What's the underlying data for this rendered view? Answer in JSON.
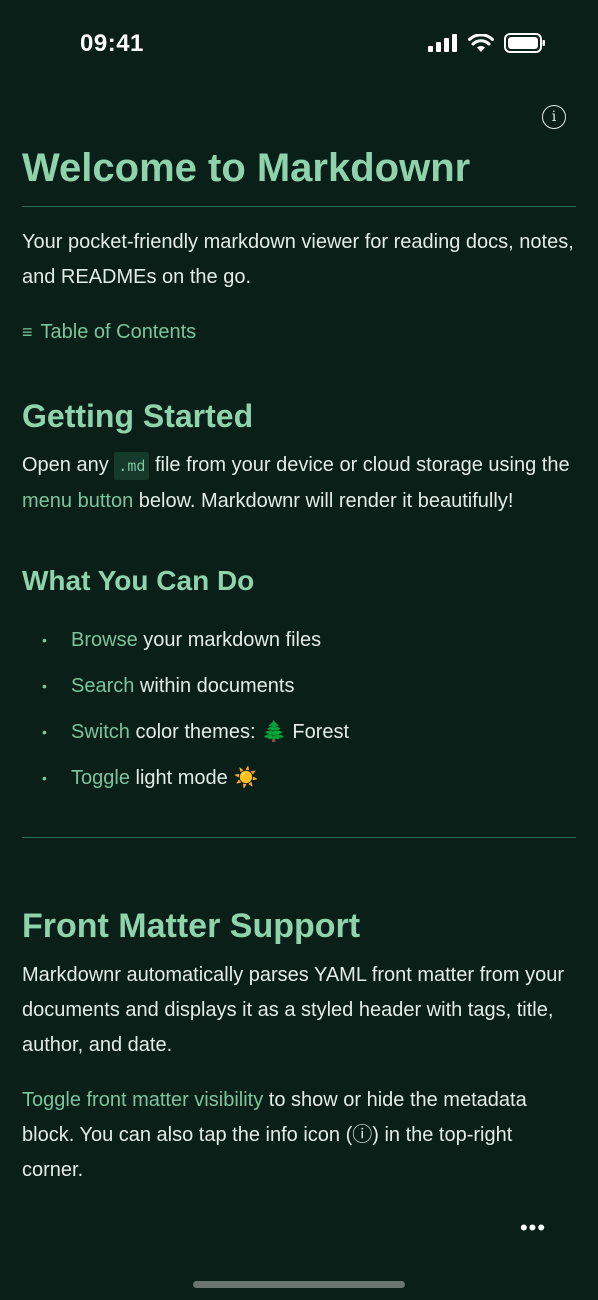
{
  "status_bar": {
    "time": "09:41",
    "icons": [
      "cellular-signal-icon",
      "wifi-icon",
      "battery-icon"
    ]
  },
  "header": {
    "info_icon": "info-icon",
    "info_glyph": "i"
  },
  "document": {
    "title": "Welcome to Markdownr",
    "intro": "Your pocket-friendly markdown viewer for reading docs, notes, and READMEs on the go.",
    "toc_icon": "≡",
    "toc_label": "Table of Contents",
    "getting_started": {
      "heading": "Getting Started",
      "text_1": "Open any ",
      "code": ".md",
      "text_2": " file from your device or cloud storage using the ",
      "link": "menu button",
      "text_3": " below. Markdownr will render it beautifully!"
    },
    "what_you_can_do": {
      "heading": "What You Can Do",
      "bullet_glyph": "•",
      "items": [
        {
          "link": "Browse",
          "text": " your markdown files",
          "emoji": "",
          "suffix": ""
        },
        {
          "link": "Search",
          "text": " within documents",
          "emoji": "",
          "suffix": ""
        },
        {
          "link": "Switch",
          "text": " color themes:",
          "emoji": "🌲",
          "suffix": "Forest"
        },
        {
          "link": "Toggle",
          "text": " light mode",
          "emoji": "☀️",
          "suffix": ""
        }
      ]
    },
    "front_matter": {
      "heading": "Front Matter Support",
      "paragraph": "Markdownr automatically parses YAML front matter from your documents and displays it as a styled header with tags, title, author, and date.",
      "toggle_link": "Toggle front matter visibility",
      "toggle_text": " to show or hide the metadata block. You can also tap the info icon (ⓘ) in the top-right corner."
    }
  },
  "more_button": {
    "label": "•••"
  },
  "colors": {
    "background": "#0a1f18",
    "heading": "#8fd3ac",
    "link": "#7cc49d",
    "text": "#e3ece7",
    "divider": "#2f6a52"
  }
}
